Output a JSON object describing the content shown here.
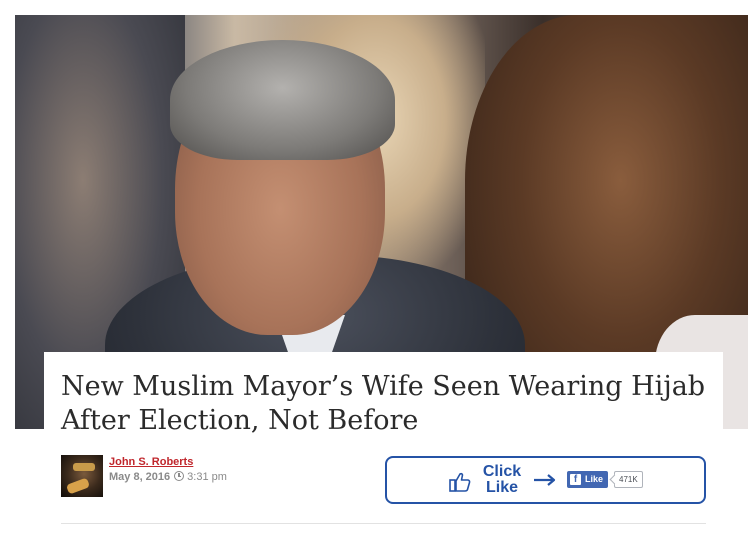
{
  "article": {
    "headline": "New Muslim Mayor’s Wife Seen Wearing Hijab After Election, Not Before"
  },
  "author": {
    "name": "John S. Roberts",
    "date": "May 8, 2016",
    "time": "3:31 pm",
    "clock_icon": "clock-icon"
  },
  "like_box": {
    "click_label": "Click",
    "like_label": "Like",
    "fb_button_label": "Like",
    "fb_logo_letter": "f",
    "fb_count": "471K",
    "icons": [
      "thumbs-up-icon",
      "arrow-right-icon",
      "facebook-icon"
    ]
  },
  "colors": {
    "author_link": "#c0262c",
    "accent_blue": "#2553a6",
    "facebook_blue": "#4267b2",
    "headline_text": "#2b2b2b"
  }
}
